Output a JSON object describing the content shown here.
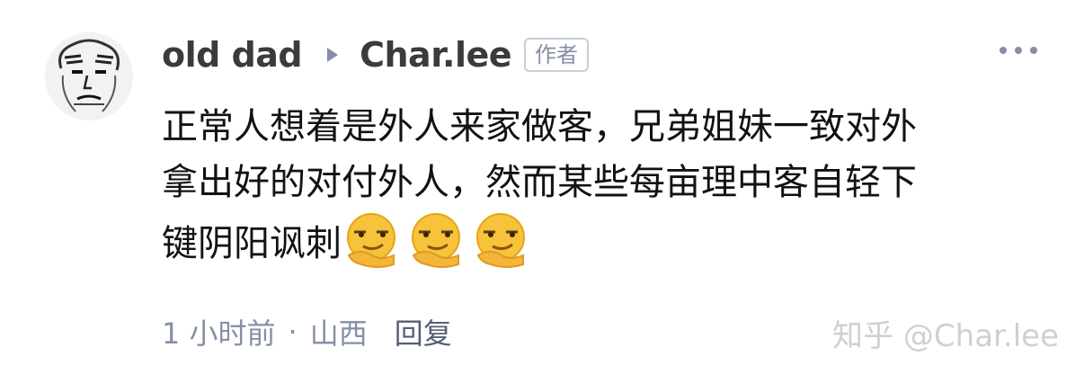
{
  "comment": {
    "author": "old dad",
    "reply_to": "Char.lee",
    "badge": "作者",
    "lines": [
      "正常人想着是外人来家做客，兄弟姐妹一致对外",
      "拿出好的对付外人，然而某些每亩理中客自轻下",
      "键阴阳讽刺"
    ],
    "emojis": [
      "smirk-emoji",
      "smirk-emoji",
      "smirk-emoji"
    ],
    "time": "1 小时前",
    "separator": "·",
    "location": "山西",
    "reply_label": "回复"
  },
  "watermark": "知乎 @Char.lee",
  "colors": {
    "meta": "#8590a6",
    "text": "#121212",
    "emoji_face": "#f6c33b"
  }
}
